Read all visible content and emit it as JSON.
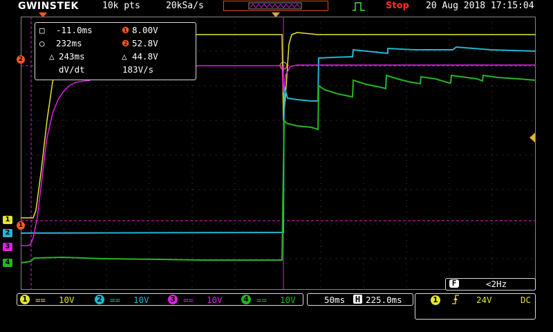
{
  "header": {
    "brand": "GWINSTEK",
    "memory_length": "10k pts",
    "sample_rate": "20kSa/s",
    "run_state": "Stop",
    "datetime": "20 Aug 2018 17:15:04"
  },
  "colors": {
    "ch1": "#e6e632",
    "ch2": "#22b8d0",
    "ch3": "#e41ee4",
    "ch4": "#22b822",
    "accent": "#ff5a22"
  },
  "cursor_box": {
    "h_cursor_a": "-11.0ms",
    "h_cursor_b": "232ms",
    "delta_t": "243ms",
    "slope_label": "dV/dt",
    "v_cursor_1": "8.00V",
    "v_cursor_2": "52.8V",
    "delta_v": "44.8V",
    "slope_value": "183V/s"
  },
  "channel_markers": [
    "1",
    "2",
    "3",
    "4"
  ],
  "freq": {
    "icon": "F",
    "value": "<2Hz"
  },
  "bottom": {
    "ch1": {
      "num": "1",
      "coupling": "==",
      "scale": "10V"
    },
    "ch2": {
      "num": "2",
      "coupling": "==",
      "scale": "10V"
    },
    "ch3": {
      "num": "3",
      "coupling": "==",
      "scale": "10V"
    },
    "ch4": {
      "num": "4",
      "coupling": "==",
      "scale": "10V"
    },
    "timebase": "50ms",
    "horiz_icon": "H",
    "horiz_position": "225.0ms",
    "trigger_source": "1",
    "trigger_level": "24V",
    "trigger_coupling": "DC"
  }
}
